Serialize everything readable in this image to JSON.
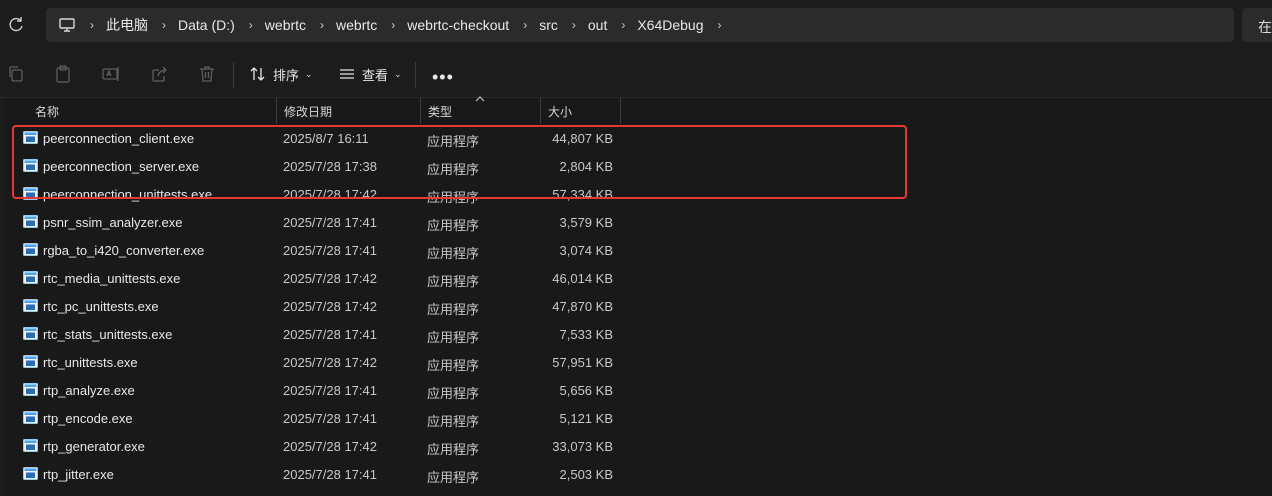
{
  "address_bar": {
    "breadcrumbs": [
      "此电脑",
      "Data (D:)",
      "webrtc",
      "webrtc",
      "webrtc-checkout",
      "src",
      "out",
      "X64Debug"
    ],
    "search_text": "在"
  },
  "toolbar": {
    "sort_label": "排序",
    "view_label": "查看",
    "more_label": "•••"
  },
  "columns": {
    "name": "名称",
    "date": "修改日期",
    "type": "类型",
    "size": "大小"
  },
  "files": [
    {
      "name": "peerconnection_client.exe",
      "date": "2025/8/7 16:11",
      "type": "应用程序",
      "size": "44,807 KB"
    },
    {
      "name": "peerconnection_server.exe",
      "date": "2025/7/28 17:38",
      "type": "应用程序",
      "size": "2,804 KB"
    },
    {
      "name": "peerconnection_unittests.exe",
      "date": "2025/7/28 17:42",
      "type": "应用程序",
      "size": "57,334 KB"
    },
    {
      "name": "psnr_ssim_analyzer.exe",
      "date": "2025/7/28 17:41",
      "type": "应用程序",
      "size": "3,579 KB"
    },
    {
      "name": "rgba_to_i420_converter.exe",
      "date": "2025/7/28 17:41",
      "type": "应用程序",
      "size": "3,074 KB"
    },
    {
      "name": "rtc_media_unittests.exe",
      "date": "2025/7/28 17:42",
      "type": "应用程序",
      "size": "46,014 KB"
    },
    {
      "name": "rtc_pc_unittests.exe",
      "date": "2025/7/28 17:42",
      "type": "应用程序",
      "size": "47,870 KB"
    },
    {
      "name": "rtc_stats_unittests.exe",
      "date": "2025/7/28 17:41",
      "type": "应用程序",
      "size": "7,533 KB"
    },
    {
      "name": "rtc_unittests.exe",
      "date": "2025/7/28 17:42",
      "type": "应用程序",
      "size": "57,951 KB"
    },
    {
      "name": "rtp_analyze.exe",
      "date": "2025/7/28 17:41",
      "type": "应用程序",
      "size": "5,656 KB"
    },
    {
      "name": "rtp_encode.exe",
      "date": "2025/7/28 17:41",
      "type": "应用程序",
      "size": "5,121 KB"
    },
    {
      "name": "rtp_generator.exe",
      "date": "2025/7/28 17:42",
      "type": "应用程序",
      "size": "33,073 KB"
    },
    {
      "name": "rtp_jitter.exe",
      "date": "2025/7/28 17:41",
      "type": "应用程序",
      "size": "2,503 KB"
    }
  ],
  "colors": {
    "highlight": "#e53935",
    "exe_icon_blue": "#4aa3f0"
  },
  "icons": {
    "refresh": "refresh-icon",
    "pc": "computer-icon",
    "copy": "copy-icon",
    "paste": "paste-icon",
    "rename": "rename-icon",
    "share": "share-icon",
    "delete": "delete-icon",
    "sort": "sort-icon",
    "view": "view-icon",
    "exe": "exe-file-icon"
  }
}
